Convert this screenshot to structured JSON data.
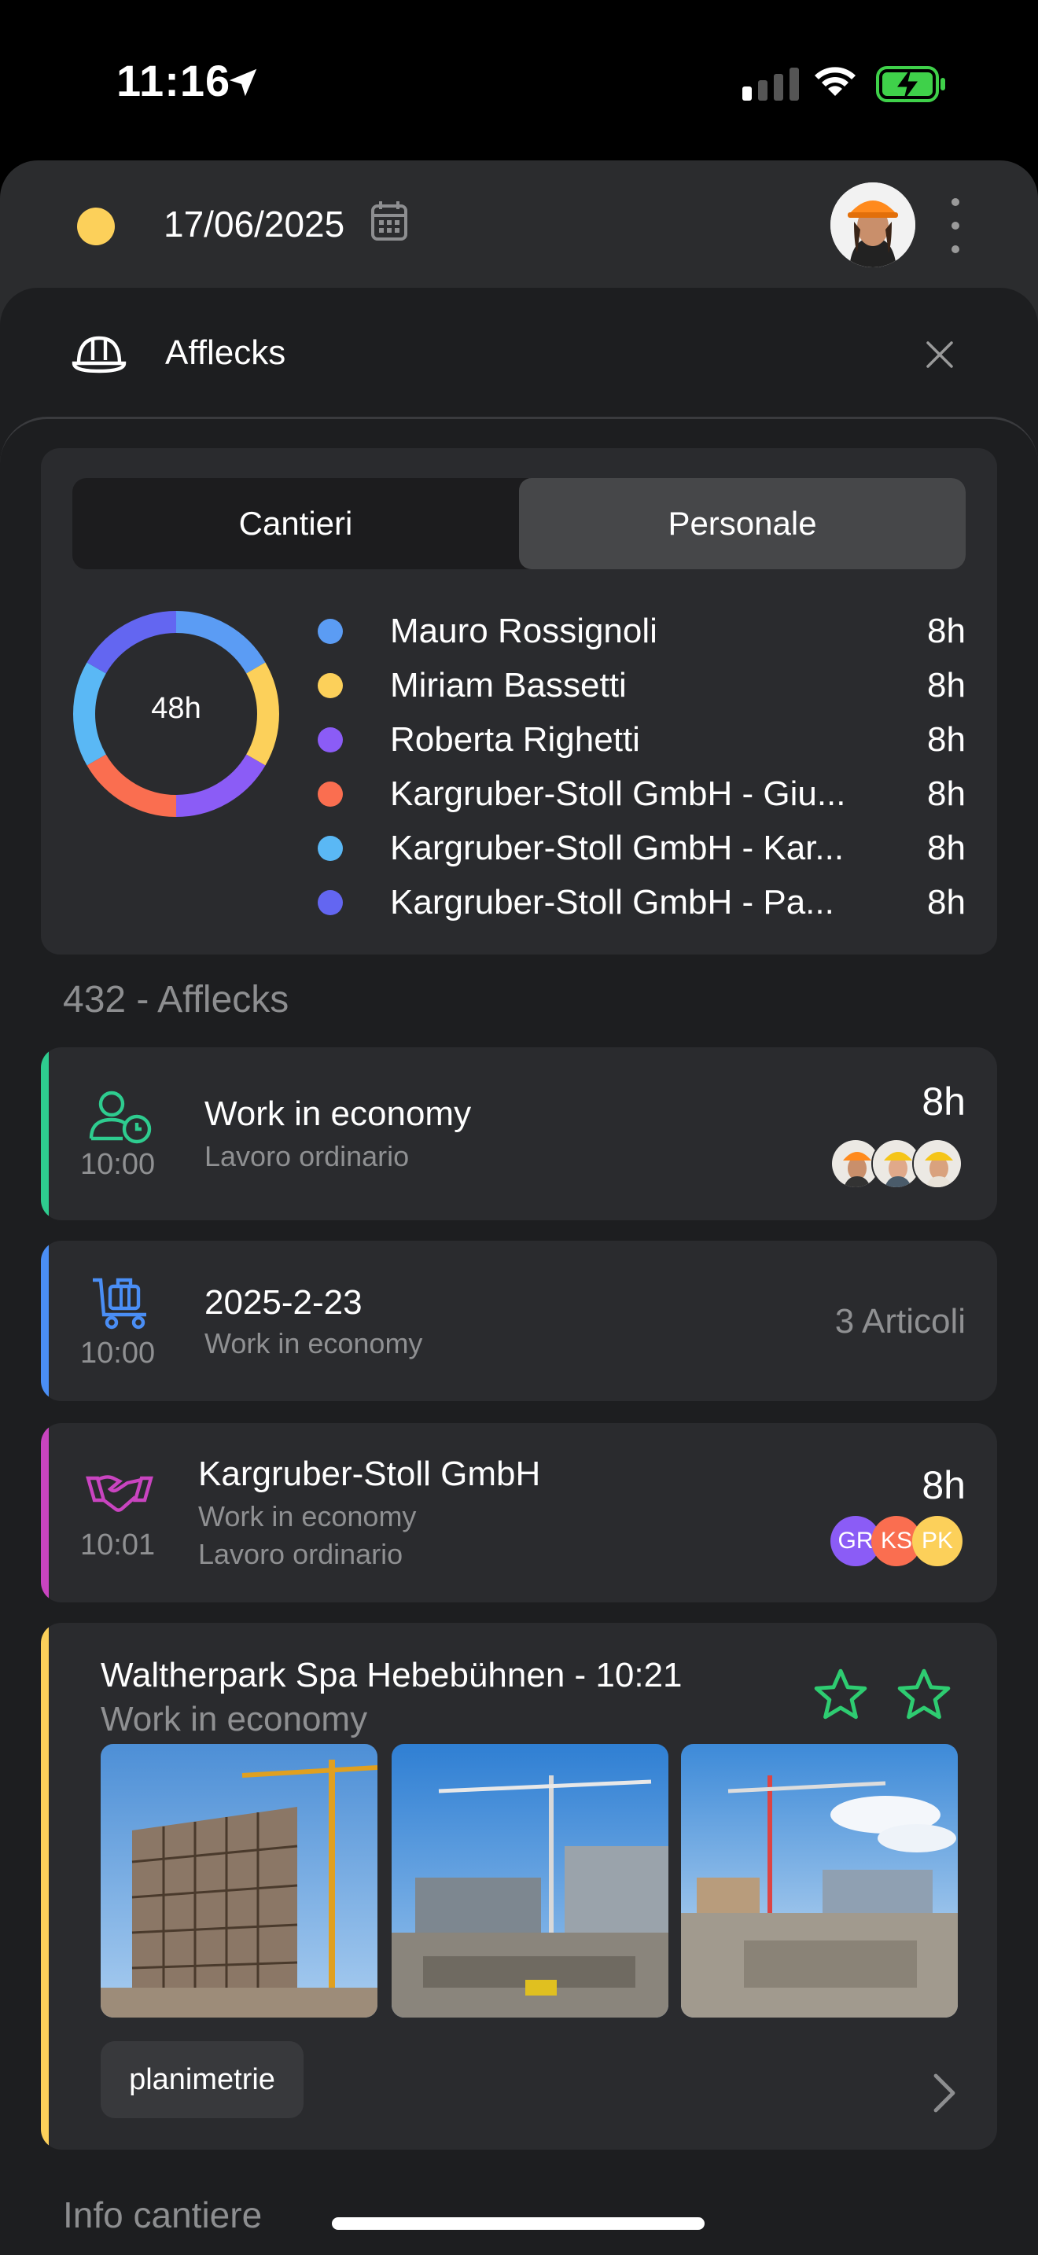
{
  "status_bar": {
    "time": "11:16"
  },
  "header": {
    "date": "17/06/2025",
    "status_color": "#fcd05a"
  },
  "sheet": {
    "title": "Afflecks"
  },
  "summary": {
    "tabs": [
      {
        "label": "Cantieri",
        "active": false
      },
      {
        "label": "Personale",
        "active": true
      }
    ],
    "total": "48h",
    "legend": [
      {
        "name": "Mauro Rossignoli",
        "value": "8h",
        "color": "#5b9cf4"
      },
      {
        "name": "Miriam Bassetti",
        "value": "8h",
        "color": "#fcd05a"
      },
      {
        "name": "Roberta Righetti",
        "value": "8h",
        "color": "#8b5cf6"
      },
      {
        "name": "Kargruber-Stoll GmbH - Giu...",
        "value": "8h",
        "color": "#fa6e50"
      },
      {
        "name": "Kargruber-Stoll GmbH - Kar...",
        "value": "8h",
        "color": "#5ab8f5"
      },
      {
        "name": "Kargruber-Stoll GmbH - Pa...",
        "value": "8h",
        "color": "#6366f1"
      }
    ],
    "chart_data": {
      "type": "pie",
      "categories": [
        "Mauro Rossignoli",
        "Miriam Bassetti",
        "Roberta Righetti",
        "Kargruber-Stoll GmbH - Giu...",
        "Kargruber-Stoll GmbH - Kar...",
        "Kargruber-Stoll GmbH - Pa..."
      ],
      "values": [
        8,
        8,
        8,
        8,
        8,
        8
      ]
    }
  },
  "section_title": "432 - Afflecks",
  "cards": {
    "economy": {
      "time": "10:00",
      "title": "Work in economy",
      "subtitle": "Lavoro ordinario",
      "hours": "8h",
      "stripe_color": "#2ecc8f"
    },
    "material": {
      "time": "10:00",
      "title": "2025-2-23",
      "subtitle": "Work in economy",
      "count": "3 Articoli",
      "stripe_color": "#4a8ef5"
    },
    "subcontract": {
      "time": "10:01",
      "title": "Kargruber-Stoll GmbH",
      "subtitle1": "Work in economy",
      "subtitle2": "Lavoro ordinario",
      "hours": "8h",
      "stripe_color": "#c944c0",
      "initials": [
        {
          "text": "GR",
          "color": "#8b5cf6"
        },
        {
          "text": "KS",
          "color": "#fa6e50"
        },
        {
          "text": "PK",
          "color": "#fcd05a"
        }
      ]
    },
    "report": {
      "title": "Waltherpark Spa Hebebühnen - 10:21",
      "subtitle": "Work in economy",
      "chip": "planimetrie",
      "stripe_color": "#fcd05a"
    }
  },
  "footer_title": "Info cantiere"
}
